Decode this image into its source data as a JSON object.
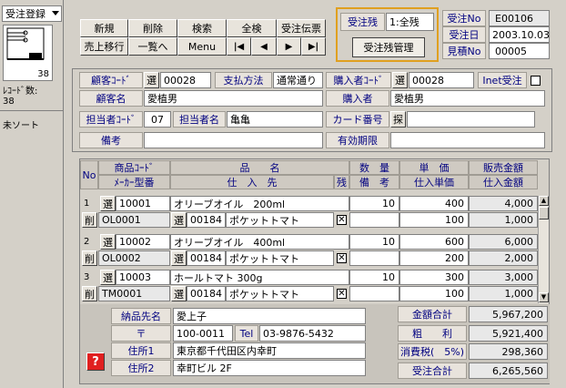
{
  "sidebar": {
    "module": "受注登録",
    "record_value": "38",
    "record_label": "ﾚｺｰﾄﾞ数:",
    "record_count": "38",
    "sort_label": "未ソート"
  },
  "toolbar": {
    "new": "新規",
    "delete": "削除",
    "search": "検索",
    "all_check": "全検",
    "order_slip": "受注伝票",
    "sales_transfer": "売上移行",
    "list": "一覧へ",
    "menu": "Menu"
  },
  "balance": {
    "label": "受注残",
    "value": "1:全残",
    "manage_button": "受注残管理"
  },
  "order_info": {
    "no_label": "受注No",
    "no_value": "E00106",
    "date_label": "受注日",
    "date_value": "2003.10.03",
    "quote_label": "見積No",
    "quote_value": "00005"
  },
  "customer": {
    "code_label": "顧客ｺｰﾄﾞ",
    "code_select": "選",
    "code_value": "00028",
    "payment_label": "支払方法",
    "payment_value": "通常通り",
    "buyer_code_label": "購入者ｺｰﾄﾞ",
    "buyer_code_select": "選",
    "buyer_code_value": "00028",
    "inet_label": "Inet受注",
    "name_label": "顧客名",
    "name_value": "愛植男",
    "buyer_label": "購入者",
    "buyer_value": "愛植男",
    "staff_code_label": "担当者ｺｰﾄﾞ",
    "staff_code_value": "07",
    "staff_name_label": "担当者名",
    "staff_name_value": "亀亀",
    "card_label": "カード番号",
    "card_search": "探",
    "note_label": "備考",
    "expiry_label": "有効期限"
  },
  "table": {
    "headers": {
      "no": "No",
      "code": "商品ｺｰﾄﾞ",
      "maker": "ﾒｰｶｰ型番",
      "item": "品　　名",
      "supplier": "仕　入　先",
      "remain": "残",
      "qty": "数　量",
      "note": "備　考",
      "price": "単　価",
      "cost_price": "仕入単価",
      "sales": "販売金額",
      "cost": "仕入金額"
    },
    "select": "選",
    "delete": "削",
    "rows": [
      {
        "no": "1",
        "code": "10001",
        "maker": "OL0001",
        "item": "オリーブオイル　200ml",
        "sup_code": "00184",
        "sup_name": "ポケットトマト",
        "qty": "10",
        "price": "400",
        "cost_price": "100",
        "sales": "4,000",
        "cost": "1,000"
      },
      {
        "no": "2",
        "code": "10002",
        "maker": "OL0002",
        "item": "オリーブオイル　400ml",
        "sup_code": "00184",
        "sup_name": "ポケットトマト",
        "qty": "10",
        "price": "600",
        "cost_price": "200",
        "sales": "6,000",
        "cost": "2,000"
      },
      {
        "no": "3",
        "code": "10003",
        "maker": "TM0001",
        "item": "ホールトマト 300g",
        "sup_code": "00184",
        "sup_name": "ポケットトマト",
        "qty": "10",
        "price": "300",
        "cost_price": "100",
        "sales": "3,000",
        "cost": "1,000"
      }
    ]
  },
  "delivery": {
    "name_label": "納品先名",
    "name_value": "愛上子",
    "zip_label": "〒",
    "zip_value": "100-0011",
    "tel_label": "Tel",
    "tel_value": "03-9876-5432",
    "addr1_label": "住所1",
    "addr1_value": "東京都千代田区内幸町",
    "addr2_label": "住所2",
    "addr2_value": "幸町ビル 2F",
    "help": "?"
  },
  "totals": {
    "amount_label": "金額合計",
    "amount_value": "5,967,200",
    "profit_label": "粗　　利",
    "profit_value": "5,921,400",
    "tax_label": "消費税(　5%)",
    "tax_value": "298,360",
    "order_label": "受注合計",
    "order_value": "6,265,560"
  }
}
